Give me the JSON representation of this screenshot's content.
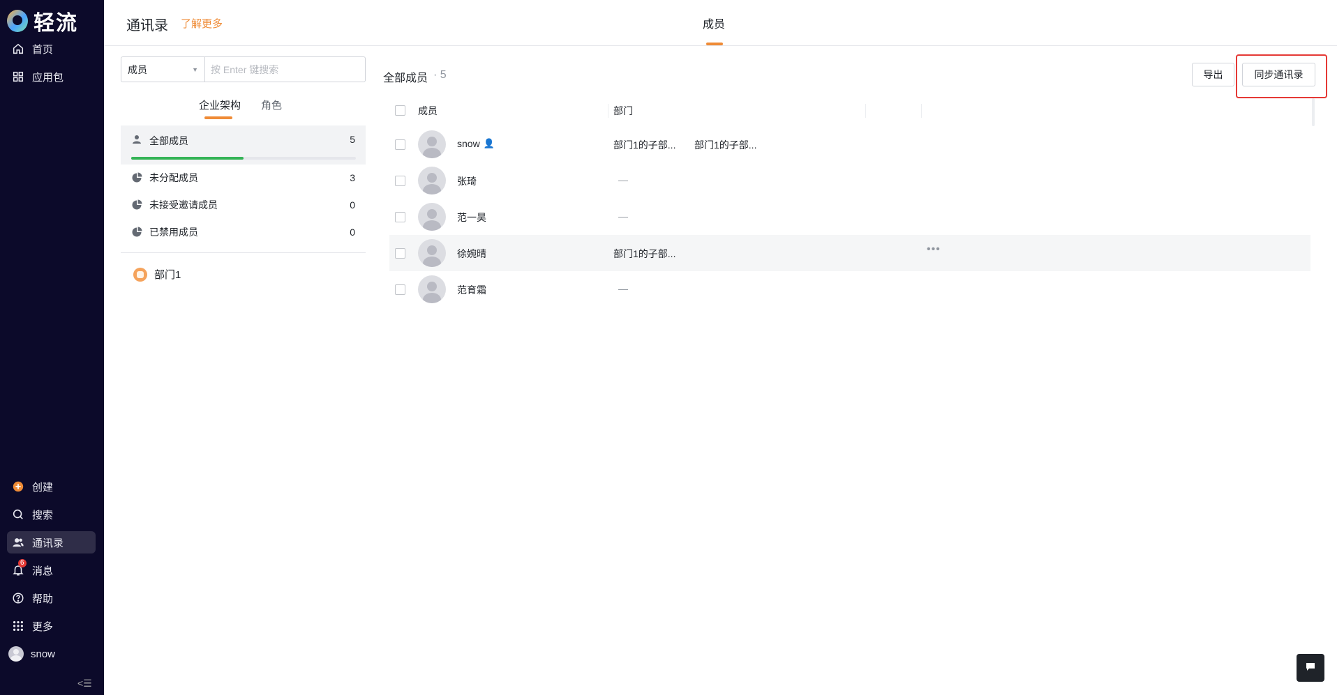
{
  "app": {
    "name": "轻流"
  },
  "sidebar": {
    "top_items": [
      {
        "label": "首页",
        "icon": "home-icon"
      },
      {
        "label": "应用包",
        "icon": "grid-icon"
      }
    ],
    "bottom_items": [
      {
        "label": "创建",
        "icon": "plus-circle-icon"
      },
      {
        "label": "搜索",
        "icon": "search-icon"
      },
      {
        "label": "通讯录",
        "icon": "contacts-icon",
        "active": true
      },
      {
        "label": "消息",
        "icon": "bell-icon",
        "badge": "6"
      },
      {
        "label": "帮助",
        "icon": "help-icon"
      },
      {
        "label": "更多",
        "icon": "dots-grid-icon"
      },
      {
        "label": "snow",
        "icon": "user-avatar"
      }
    ],
    "collapse_icon": "collapse-icon"
  },
  "header": {
    "title": "通讯录",
    "learn_more": "了解更多",
    "tab": "成员",
    "accent_color": "#ef8b36"
  },
  "left_panel": {
    "search": {
      "type": "成员",
      "placeholder": "按 Enter 键搜索"
    },
    "tabs": [
      "企业架构",
      "角色"
    ],
    "groups": [
      {
        "label": "全部成员",
        "count": "5",
        "progress": 0.5
      },
      {
        "label": "未分配成员",
        "count": "3"
      },
      {
        "label": "未接受邀请成员",
        "count": "0"
      },
      {
        "label": "已禁用成员",
        "count": "0"
      }
    ],
    "departments": [
      {
        "label": "部门1"
      }
    ]
  },
  "main": {
    "title": "全部成员",
    "count": "· 5",
    "buttons": {
      "export": "导出",
      "sync": "同步通讯录"
    },
    "columns": [
      "成员",
      "部门"
    ],
    "rows": [
      {
        "name": "snow",
        "admin": true,
        "depts": [
          "部门1的子部...",
          "部门1的子部..."
        ]
      },
      {
        "name": "张琦",
        "depts": [],
        "empty": "—"
      },
      {
        "name": "范一昊",
        "depts": [],
        "empty": "—"
      },
      {
        "name": "徐婉晴",
        "depts": [
          "部门1的子部..."
        ],
        "more": "•••"
      },
      {
        "name": "范育霜",
        "depts": [],
        "empty": "—"
      }
    ]
  }
}
